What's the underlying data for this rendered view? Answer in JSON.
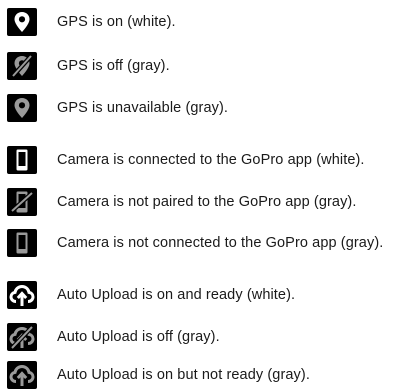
{
  "colors": {
    "icon_background": "#000000",
    "icon_white": "#ffffff",
    "icon_gray": "#9a9a9a"
  },
  "gps": [
    {
      "icon": "gps-pin-icon",
      "state": "white",
      "label": "GPS is on (white)."
    },
    {
      "icon": "gps-off-icon",
      "state": "gray",
      "label": "GPS is off (gray)."
    },
    {
      "icon": "gps-pin-icon",
      "state": "gray",
      "label": "GPS is unavailable (gray)."
    }
  ],
  "camera": [
    {
      "icon": "phone-icon",
      "state": "white",
      "label": "Camera is connected to the GoPro app (white)."
    },
    {
      "icon": "phone-slash-icon",
      "state": "gray",
      "label": "Camera is not paired to the GoPro app (gray)."
    },
    {
      "icon": "phone-icon",
      "state": "gray",
      "label": "Camera is not connected to the GoPro app (gray)."
    }
  ],
  "upload": [
    {
      "icon": "cloud-upload-icon",
      "state": "white",
      "label": "Auto Upload is on and ready (white)."
    },
    {
      "icon": "cloud-upload-off-icon",
      "state": "gray",
      "label": "Auto Upload is off (gray)."
    },
    {
      "icon": "cloud-upload-icon",
      "state": "gray",
      "label": "Auto Upload is on but not ready (gray)."
    }
  ]
}
